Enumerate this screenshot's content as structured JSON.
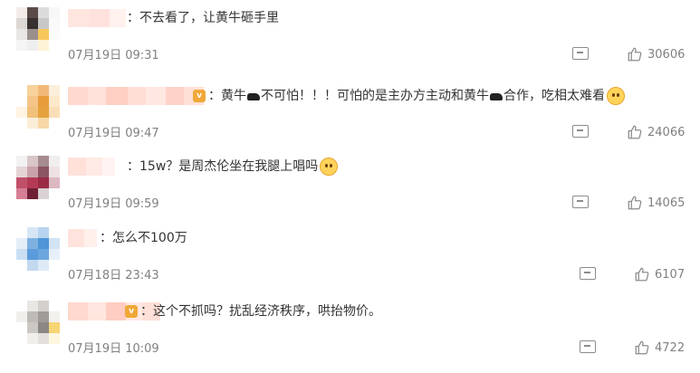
{
  "comments": [
    {
      "text": "：不去看了，让黄牛砸手里",
      "time": "07月19日 09:31",
      "likes": "30606",
      "avatar_colors": [
        "#f4ece9",
        "#5a4b48",
        "#dcdcdc",
        "#f7f7f7",
        "#dcd7d2",
        "#383030",
        "#c8c8c8",
        "#f9f9f9",
        "#e9e7e5",
        "#9a8f8c",
        "#f7c85c",
        "#fbfbfb",
        "#f5f5f5",
        "#eeeeee",
        "#fff3d6",
        "#ffffff",
        "#ffffff",
        "#ffffff",
        "#ffffff",
        "#ffffff"
      ],
      "name_colors": [
        "#ffe7e0",
        "#ffe2dd",
        "#fff1ed"
      ],
      "has_badge": false,
      "emoji": false
    },
    {
      "text_parts": [
        "：黄牛",
        "不可怕！！！可怕的是主办方主动和黄牛",
        "合作，吃相太难看"
      ],
      "time": "07月19日 09:47",
      "likes": "24066",
      "avatar_colors": [
        "#ffffff",
        "#f7d29b",
        "#f2b979",
        "#fbeedb",
        "#ffffff",
        "#f4c488",
        "#e89c3a",
        "#fde9c9",
        "#fff4e2",
        "#f1c07a",
        "#e5a23f",
        "#f9dfb7",
        "#ffffff",
        "#fbeed7",
        "#f7d8a7",
        "#ffffff",
        "#ffffff",
        "#ffffff",
        "#ffffff",
        "#ffffff"
      ],
      "name_colors": [
        "#ffd9cf",
        "#ffe3da",
        "#ffcfc3",
        "#ffddd4",
        "#ffe8e1",
        "#ffd2c8",
        "#ffe0d6"
      ],
      "has_badge": true,
      "badge_text": "v",
      "emoji": true
    },
    {
      "text": "：15w？是周杰伦坐在我腿上唱吗",
      "time": "07月19日 09:59",
      "likes": "14065",
      "avatar_colors": [
        "#f3f2f2",
        "#d9c6c8",
        "#a68b8f",
        "#f1eeee",
        "#e5d4d6",
        "#c9a3a9",
        "#8c5563",
        "#efe1e3",
        "#c04f6a",
        "#b43a56",
        "#9a2b45",
        "#dcb8c1",
        "#d67e94",
        "#6f1f34",
        "#d9d1d3",
        "#ffffff",
        "#ffffff",
        "#ffffff",
        "#ffffff",
        "#ffffff"
      ],
      "name_colors": [
        "#ffe1da",
        "#ffeae5",
        "#fff4f1"
      ],
      "has_badge": false,
      "emoji": true
    },
    {
      "text": "：怎么不100万",
      "time": "07月18日 23:43",
      "likes": "6107",
      "avatar_colors": [
        "#ffffff",
        "#d6e6f5",
        "#b8d4ee",
        "#ffffff",
        "#e4eef8",
        "#7fb1e0",
        "#4f95d8",
        "#d2e3f4",
        "#c9def3",
        "#5a9cdb",
        "#6ca6de",
        "#e7f0fa",
        "#ffffff",
        "#c2d9f0",
        "#dfeaf7",
        "#ffffff",
        "#ffffff",
        "#ffffff",
        "#ffffff",
        "#ffffff"
      ],
      "name_colors": [
        "#ffe3dc",
        "#fff0ec"
      ],
      "has_badge": false,
      "emoji": false
    },
    {
      "text": "：这个不抓吗？扰乱经济秩序，哄抬物价。",
      "time": "07月19日 10:09",
      "likes": "4722",
      "avatar_colors": [
        "#ffffff",
        "#e9e7e4",
        "#d4d1cd",
        "#ffffff",
        "#f1efec",
        "#bebbb7",
        "#9f9b97",
        "#f3f1ee",
        "#ffffff",
        "#cbc8c4",
        "#8a8784",
        "#f7d474",
        "#ffffff",
        "#f1efec",
        "#e3e0dc",
        "#fff6df",
        "#ffffff",
        "#ffffff",
        "#ffffff",
        "#ffffff"
      ],
      "name_colors": [
        "#ffd8cf",
        "#ffe6de",
        "#ffcdc2",
        "#ffe9e3",
        "#ffdfd7"
      ],
      "has_badge": true,
      "badge_text": "v",
      "emoji": false
    }
  ]
}
